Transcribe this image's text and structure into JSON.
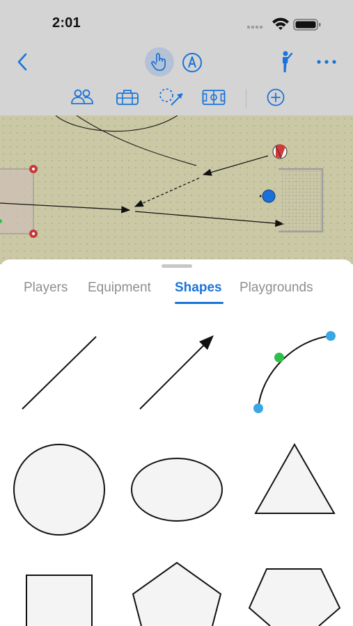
{
  "status_bar": {
    "time": "2:01",
    "icons": [
      "cellular-signal-icon",
      "wifi-icon",
      "battery-icon"
    ]
  },
  "toolbar": {
    "primary_icons": [
      "back-chevron-icon",
      "hand-pointer-icon",
      "pencil-circle-icon",
      "coach-figure-icon",
      "more-ellipsis-icon"
    ],
    "secondary_icons": [
      "players-group-icon",
      "equipment-bag-icon",
      "shape-arrow-icon",
      "field-pitch-icon",
      "add-circle-icon"
    ],
    "active_tool": "hand-pointer-icon"
  },
  "colors": {
    "accent": "#1a73d9",
    "toolbar_bg": "#d4d4d4",
    "field_bg": "#cbc9a5",
    "tab_inactive": "#8e8e93",
    "control_point_blue": "#3aa7e4",
    "control_point_green": "#2fbf4a"
  },
  "sheet": {
    "tabs": [
      {
        "label": "Players",
        "active": false
      },
      {
        "label": "Equipment",
        "active": false
      },
      {
        "label": "Shapes",
        "active": true
      },
      {
        "label": "Playgrounds",
        "active": false
      }
    ],
    "shapes": [
      "line",
      "arrow",
      "curve",
      "circle",
      "ellipse",
      "triangle",
      "square",
      "pentagon",
      "hexagon"
    ]
  }
}
